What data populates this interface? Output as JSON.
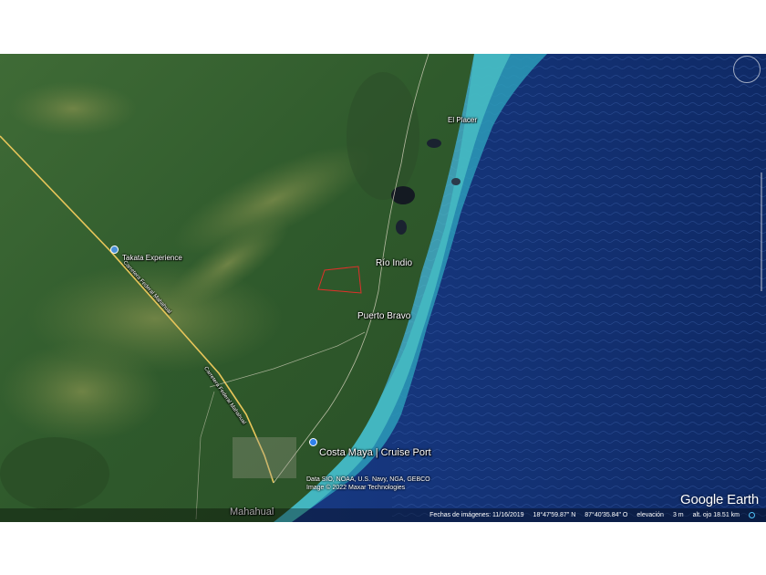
{
  "map": {
    "places": [
      {
        "id": "el-placer",
        "text": "El Placer"
      },
      {
        "id": "takata",
        "text": "Takata Experience"
      },
      {
        "id": "rio-indio",
        "text": "Río Indio"
      },
      {
        "id": "puerto-bravo",
        "text": "Puerto Bravo"
      },
      {
        "id": "costa-maya",
        "text": "Costa Maya | Cruise Port"
      },
      {
        "id": "mahahual",
        "text": "Mahahual"
      }
    ],
    "road_labels": [
      {
        "id": "road-1",
        "text": "Carretera Federal Mahahual"
      },
      {
        "id": "road-2",
        "text": "Carretera Federal Mahahual"
      }
    ],
    "attribution": [
      "Data SIO, NOAA, U.S. Navy, NGA, GEBCO",
      "Image © 2022 Maxar Technologies"
    ],
    "brand": "Google Earth",
    "polygon_color": "#e0302a",
    "pin_colors": {
      "takata": "#4a90d9",
      "costa_maya": "#2f80ed"
    }
  },
  "status_bar": {
    "imagery_date": "Fechas de imágenes: 11/16/2019",
    "latitude": "18°47'59.87\" N",
    "longitude": "87°40'35.84\" O",
    "elevation_label": "elevación",
    "elevation_value": "3 m",
    "eye_alt": "alt. ojo  18.51 km"
  }
}
